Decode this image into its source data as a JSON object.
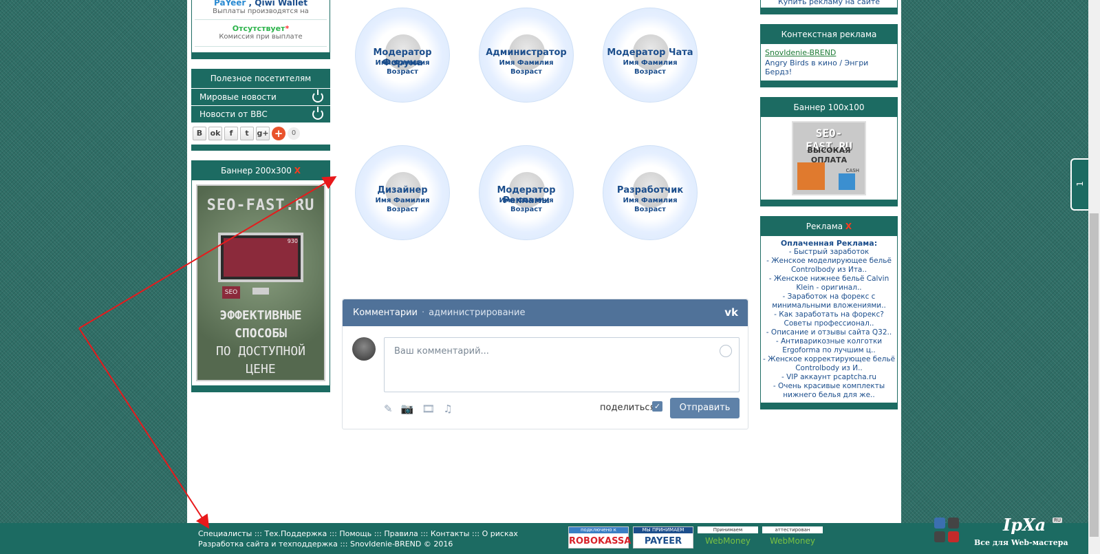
{
  "left": {
    "payments": {
      "top_line_payeer": "PaYeer",
      "top_line_sep": " , ",
      "top_line_qiwi": "Qiwi Wallet",
      "top_note": "Выплаты производятся на",
      "commission_status": "Отсутствует",
      "commission_star": "*",
      "commission_note": "Комиссия при выплате"
    },
    "useful": {
      "title": "Полезное посетителям",
      "items": [
        "Мировые новости",
        "Новости от BBC"
      ]
    },
    "share": {
      "buttons": [
        "В",
        "ok",
        "f",
        "t",
        "g+"
      ],
      "plus": "+",
      "count": "0"
    },
    "banner200": {
      "title": "Баннер 200x300",
      "close": "X",
      "site": "SEO-FAST.RU",
      "tag": "SEO",
      "counter": "930",
      "line1": "ЭФФЕКТИВНЫЕ",
      "line2": "СПОСОБЫ",
      "line3": "ПО ДОСТУПНОЙ",
      "line4": "ЦЕНЕ"
    }
  },
  "team": [
    {
      "role": "Модератор Форума",
      "name": "Имя Фамилия",
      "age": "Возраст"
    },
    {
      "role": "Администратор",
      "name": "Имя Фамилия",
      "age": "Возраст"
    },
    {
      "role": "Модератор Чата",
      "name": "Имя Фамилия",
      "age": "Возраст"
    },
    {
      "role": "Дизайнер",
      "name": "Имя Фамилия",
      "age": "Возраст"
    },
    {
      "role": "Модератор Рекламы",
      "name": "Имя Фамилия",
      "age": "Возраст"
    },
    {
      "role": "Разработчик",
      "name": "Имя Фамилия",
      "age": "Возраст"
    }
  ],
  "comments": {
    "title": "Комментарии",
    "separator": "·",
    "admin_link": "администрирование",
    "vk_logo": "vk",
    "placeholder": "Ваш комментарий...",
    "share_label": "поделиться",
    "send_label": "Отправить",
    "tools": [
      "✎",
      "📷",
      "🎞",
      "♫"
    ]
  },
  "right": {
    "top_link": "Купить рекламу на сайте",
    "context": {
      "title": "Контекстная реклама",
      "link": "SnovIdenie-BREND",
      "desc": "Angry Birds в кино / Энгри Бердз!"
    },
    "banner100": {
      "title": "Баннер 100x100",
      "site": "SEO-FAST.RU",
      "line1": "ВЫСОКАЯ",
      "line2": "ОПЛАТА",
      "cash": "CASH"
    },
    "ads": {
      "title": "Реклама",
      "close": "X",
      "paid_title": "Оплаченная Реклама:",
      "items": [
        "- Быстрый заработок",
        "- Женское моделирующее бельё Controlbody из Ита..",
        "- Женское нижнее бельё Calvin Klein - оригинал..",
        "- Заработок на форекс с минимальными вложениями..",
        "- Как заработать на форекс? Советы профессионал..",
        "- Описание и отзывы сайта Q32..",
        "- Антиварикозные колготки Ergoforma по лучшим ц..",
        "- Женское корректирующее бельё Controlbody из И..",
        "- VIP аккаунт pcaptcha.ru",
        "- Очень красивые комплекты нижнего белья для же.."
      ]
    }
  },
  "footer": {
    "links": [
      "Специалисты",
      "Тех.Поддержка",
      "Помощь",
      "Правила",
      "Контакты",
      "О рисках"
    ],
    "sep": " ::: ",
    "dev_text": "Разработка сайта и техподдержка",
    "brand": "SnovIdenie-BREND © 2016",
    "badges": {
      "robokassa_top": "подключено к",
      "robokassa_main": "ROBOKASSA",
      "payeer_top": "МЫ ПРИНИМАЕМ",
      "payeer_main": "PAYEER",
      "wm1_top": "Принимаем",
      "wm1_main": "WebMoney",
      "wm2_top": "аттестирован",
      "wm2_main": "WebMoney"
    },
    "ipxa_title": "IpXa",
    "ipxa_ru": "RU",
    "ipxa_sub": "Все для Web-мастера"
  },
  "side_tab": "1",
  "colors": {
    "brand_green": "#1c6b62",
    "vk_blue": "#507299",
    "link_blue": "#1c4e8c",
    "arrow_red": "#e8191b"
  }
}
